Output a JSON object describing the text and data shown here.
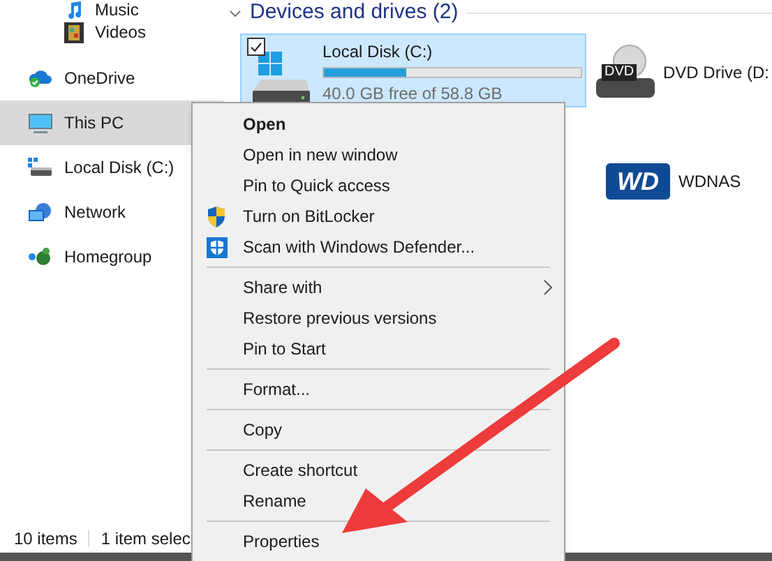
{
  "sidebar": {
    "items": [
      {
        "label": "Music",
        "kind": "music",
        "selected": false
      },
      {
        "label": "Videos",
        "kind": "video",
        "selected": false
      },
      {
        "label": "OneDrive",
        "kind": "cloud",
        "selected": false
      },
      {
        "label": "This PC",
        "kind": "pc",
        "selected": true
      },
      {
        "label": "Local Disk (C:)",
        "kind": "drive",
        "selected": false
      },
      {
        "label": "Network",
        "kind": "network",
        "selected": false
      },
      {
        "label": "Homegroup",
        "kind": "homegroup",
        "selected": false
      }
    ]
  },
  "section": {
    "title": "Devices and drives (2)",
    "expanded": true
  },
  "drives": [
    {
      "name": "Local Disk (C:)",
      "kind": "disk",
      "selected": true,
      "checked": true,
      "level": 0.32,
      "free": "40.0 GB free of 58.8 GB"
    },
    {
      "name": "DVD Drive (D:",
      "kind": "dvd",
      "selected": false,
      "checked": false,
      "icon_text": "DVD"
    }
  ],
  "network_locations": [
    {
      "name": "WDNAS",
      "logo_text": "WD"
    }
  ],
  "context_menu": {
    "groups": [
      [
        {
          "label": "Open",
          "bold": true,
          "submenu": false
        },
        {
          "label": "Open in new window",
          "bold": false,
          "submenu": false
        },
        {
          "label": "Pin to Quick access",
          "bold": false,
          "submenu": false
        },
        {
          "label": "Turn on BitLocker",
          "bold": false,
          "submenu": false,
          "kind": "bitlocker"
        },
        {
          "label": "Scan with Windows Defender...",
          "bold": false,
          "submenu": false,
          "kind": "defender"
        }
      ],
      [
        {
          "label": "Share with",
          "bold": false,
          "submenu": true
        },
        {
          "label": "Restore previous versions",
          "bold": false,
          "submenu": false
        },
        {
          "label": "Pin to Start",
          "bold": false,
          "submenu": false
        }
      ],
      [
        {
          "label": "Format...",
          "bold": false,
          "submenu": false
        }
      ],
      [
        {
          "label": "Copy",
          "bold": false,
          "submenu": false
        }
      ],
      [
        {
          "label": "Create shortcut",
          "bold": false,
          "submenu": false
        },
        {
          "label": "Rename",
          "bold": false,
          "submenu": false
        }
      ],
      [
        {
          "label": "Properties",
          "bold": false,
          "submenu": false
        }
      ]
    ]
  },
  "status_bar": {
    "item_count": "10 items",
    "selection": "1 item selec"
  }
}
